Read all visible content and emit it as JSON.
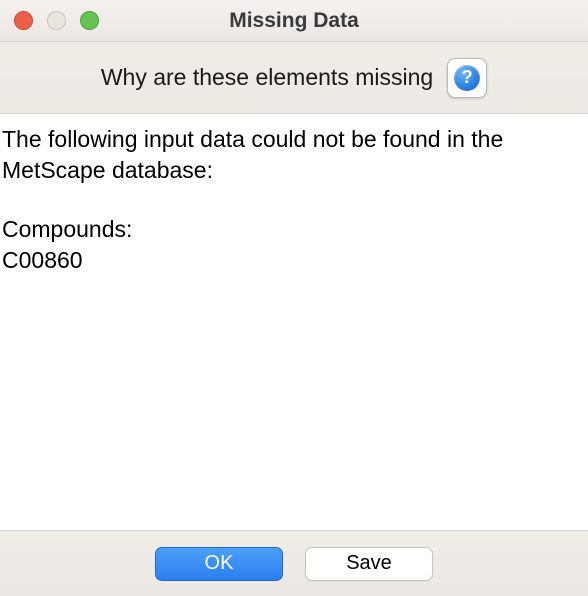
{
  "window": {
    "title": "Missing Data"
  },
  "subheader": {
    "prompt": "Why are these elements missing",
    "help_icon_label": "?"
  },
  "body": {
    "intro": "The following input data could not be found in the MetScape database:",
    "compounds_heading": "Compounds:",
    "compounds": [
      "C00860"
    ]
  },
  "buttons": {
    "ok": "OK",
    "save": "Save"
  }
}
